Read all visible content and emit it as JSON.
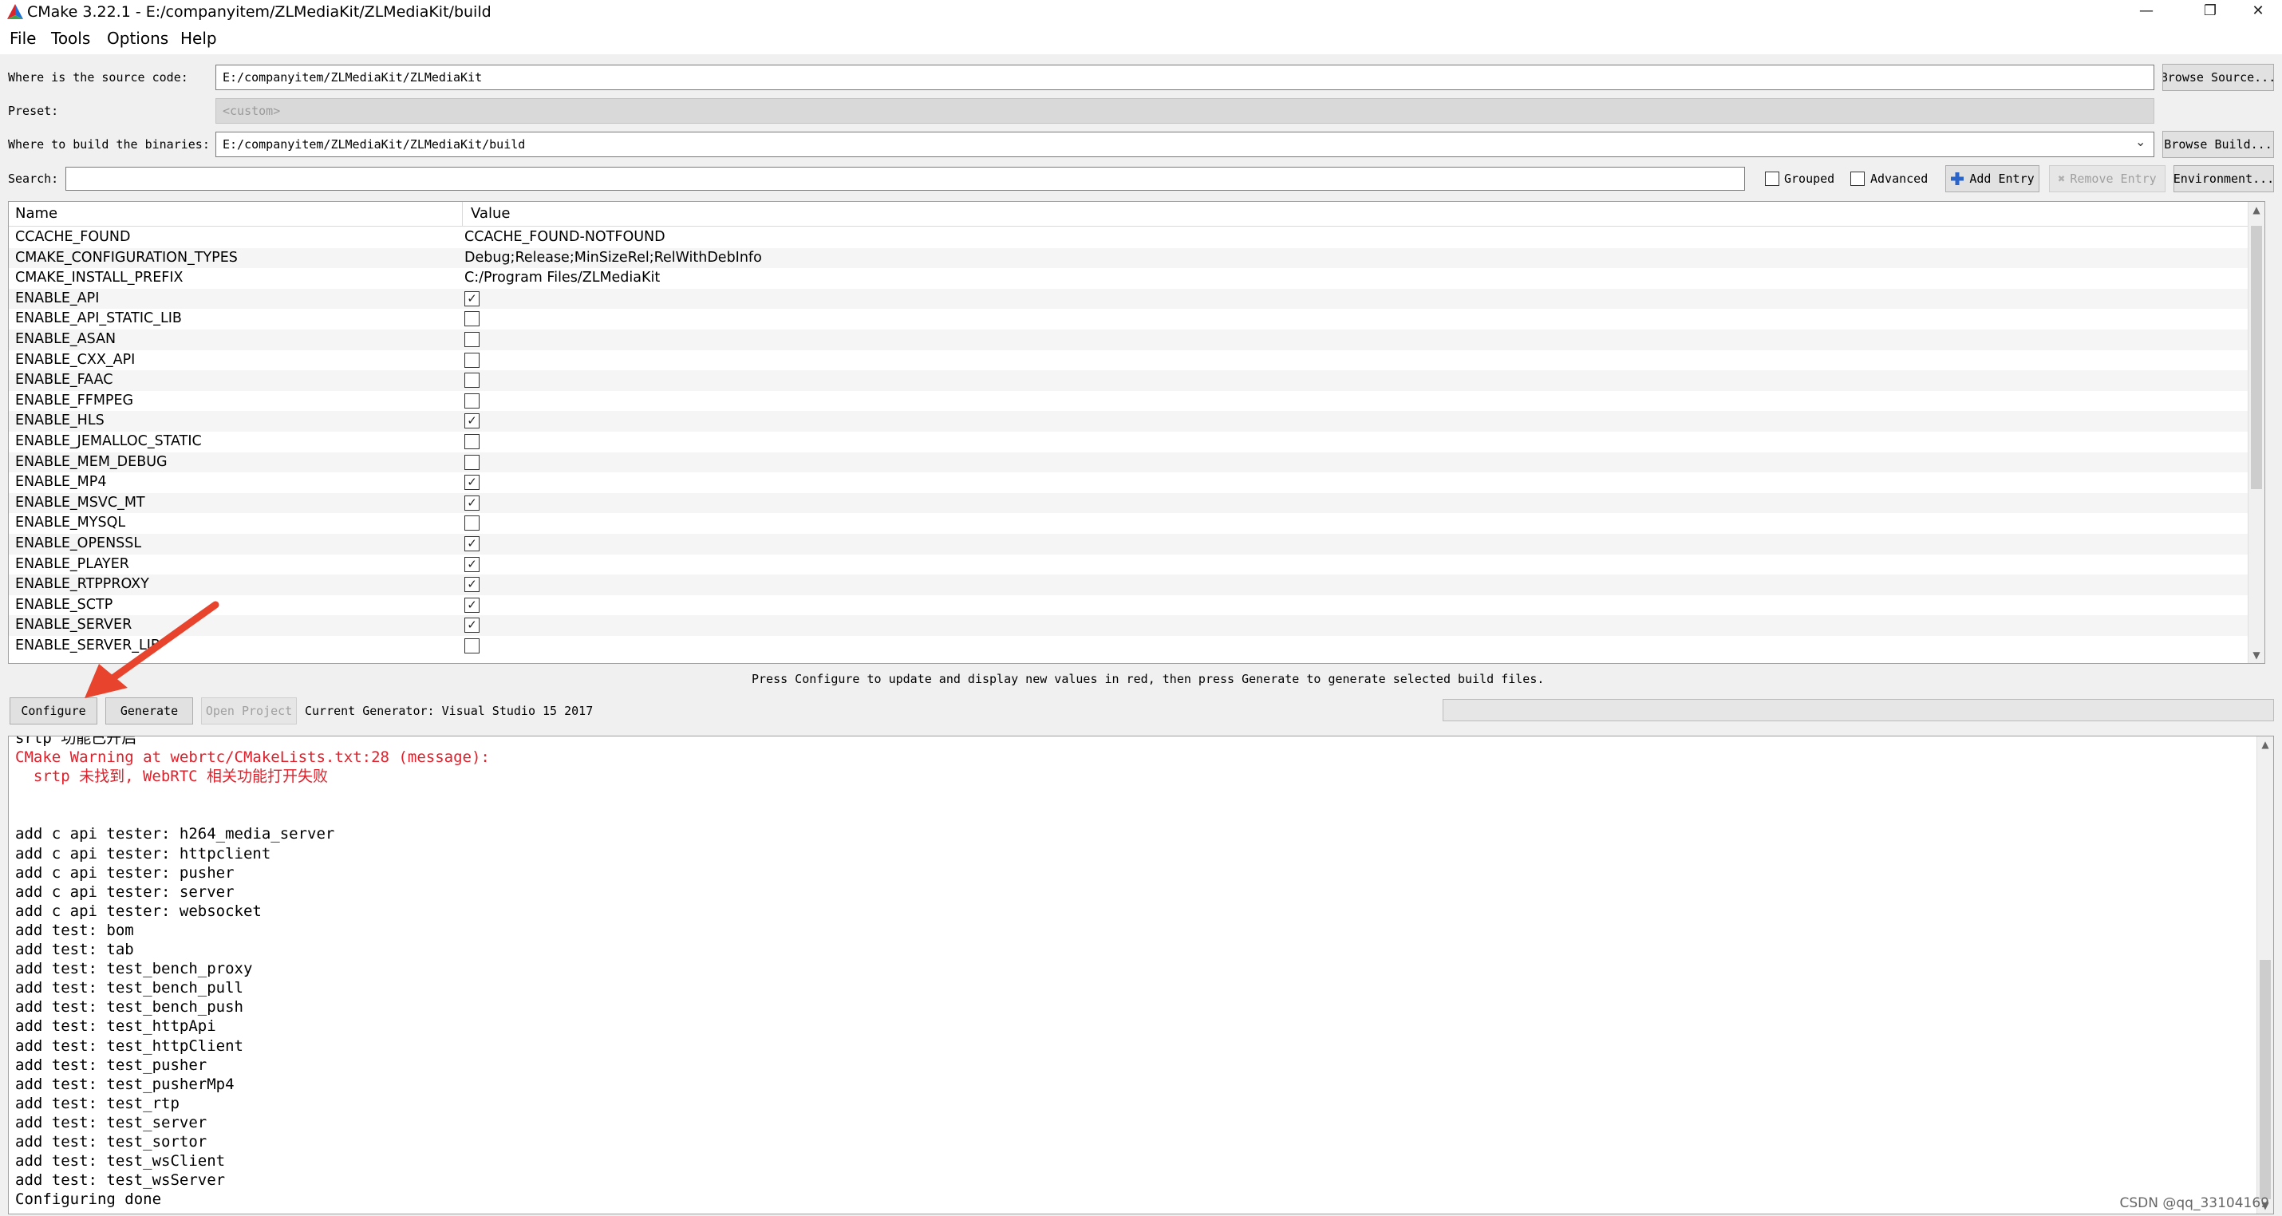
{
  "window": {
    "title": "CMake 3.22.1 - E:/companyitem/ZLMediaKit/ZLMediaKit/build",
    "minimize": "—",
    "restore": "❐",
    "close": "✕"
  },
  "menu": [
    "File",
    "Tools",
    "Options",
    "Help"
  ],
  "source": {
    "label": "Where is the source code:",
    "value": "E:/companyitem/ZLMediaKit/ZLMediaKit",
    "browse": "Browse Source..."
  },
  "preset": {
    "label": "Preset:",
    "value": "<custom>"
  },
  "build": {
    "label": "Where to build the binaries:",
    "value": "E:/companyitem/ZLMediaKit/ZLMediaKit/build",
    "browse": "Browse Build..."
  },
  "search": {
    "label": "Search:",
    "value": "",
    "grouped": "Grouped",
    "advanced": "Advanced",
    "add_entry": "Add Entry",
    "remove_entry": "Remove Entry",
    "environment": "Environment..."
  },
  "table": {
    "col_name": "Name",
    "col_value": "Value",
    "rows": [
      {
        "name": "CCACHE_FOUND",
        "value": "CCACHE_FOUND-NOTFOUND"
      },
      {
        "name": "CMAKE_CONFIGURATION_TYPES",
        "value": "Debug;Release;MinSizeRel;RelWithDebInfo"
      },
      {
        "name": "CMAKE_INSTALL_PREFIX",
        "value": "C:/Program Files/ZLMediaKit"
      },
      {
        "name": "ENABLE_API",
        "checked": true
      },
      {
        "name": "ENABLE_API_STATIC_LIB",
        "checked": false
      },
      {
        "name": "ENABLE_ASAN",
        "checked": false
      },
      {
        "name": "ENABLE_CXX_API",
        "checked": false
      },
      {
        "name": "ENABLE_FAAC",
        "checked": false
      },
      {
        "name": "ENABLE_FFMPEG",
        "checked": false
      },
      {
        "name": "ENABLE_HLS",
        "checked": true
      },
      {
        "name": "ENABLE_JEMALLOC_STATIC",
        "checked": false
      },
      {
        "name": "ENABLE_MEM_DEBUG",
        "checked": false
      },
      {
        "name": "ENABLE_MP4",
        "checked": true
      },
      {
        "name": "ENABLE_MSVC_MT",
        "checked": true
      },
      {
        "name": "ENABLE_MYSQL",
        "checked": false
      },
      {
        "name": "ENABLE_OPENSSL",
        "checked": true
      },
      {
        "name": "ENABLE_PLAYER",
        "checked": true
      },
      {
        "name": "ENABLE_RTPPROXY",
        "checked": true
      },
      {
        "name": "ENABLE_SCTP",
        "checked": true
      },
      {
        "name": "ENABLE_SERVER",
        "checked": true
      },
      {
        "name": "ENABLE_SERVER_LIB",
        "checked": false
      }
    ]
  },
  "hint": "Press Configure to update and display new values in red, then press Generate to generate selected build files.",
  "actions": {
    "configure": "Configure",
    "generate": "Generate",
    "open_project": "Open Project",
    "generator": "Current Generator: Visual Studio 15 2017"
  },
  "output": [
    {
      "text": "srtp 功能已开启",
      "warn": false
    },
    {
      "text": "CMake Warning at webrtc/CMakeLists.txt:28 (message):",
      "warn": true
    },
    {
      "text": "  srtp 未找到, WebRTC 相关功能打开失败",
      "warn": true
    },
    {
      "text": "",
      "warn": false
    },
    {
      "text": "",
      "warn": false
    },
    {
      "text": "add c api tester: h264_media_server",
      "warn": false
    },
    {
      "text": "add c api tester: httpclient",
      "warn": false
    },
    {
      "text": "add c api tester: pusher",
      "warn": false
    },
    {
      "text": "add c api tester: server",
      "warn": false
    },
    {
      "text": "add c api tester: websocket",
      "warn": false
    },
    {
      "text": "add test: bom",
      "warn": false
    },
    {
      "text": "add test: tab",
      "warn": false
    },
    {
      "text": "add test: test_bench_proxy",
      "warn": false
    },
    {
      "text": "add test: test_bench_pull",
      "warn": false
    },
    {
      "text": "add test: test_bench_push",
      "warn": false
    },
    {
      "text": "add test: test_httpApi",
      "warn": false
    },
    {
      "text": "add test: test_httpClient",
      "warn": false
    },
    {
      "text": "add test: test_pusher",
      "warn": false
    },
    {
      "text": "add test: test_pusherMp4",
      "warn": false
    },
    {
      "text": "add test: test_rtp",
      "warn": false
    },
    {
      "text": "add test: test_server",
      "warn": false
    },
    {
      "text": "add test: test_sortor",
      "warn": false
    },
    {
      "text": "add test: test_wsClient",
      "warn": false
    },
    {
      "text": "add test: test_wsServer",
      "warn": false
    },
    {
      "text": "Configuring done",
      "warn": false
    }
  ],
  "watermark": "CSDN @qq_33104169",
  "colors": {
    "warning": "#e0202a",
    "arrow": "#e8432d"
  }
}
